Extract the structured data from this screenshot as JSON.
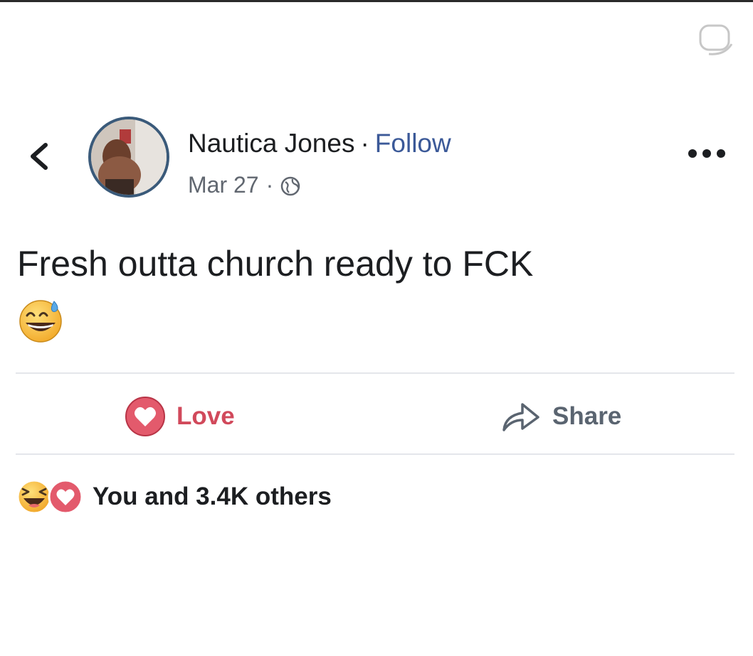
{
  "post": {
    "author": "Nautica Jones",
    "separator": "·",
    "follow_label": "Follow",
    "date": "Mar 27",
    "date_separator": "·",
    "audience_icon": "globe-icon",
    "text": "Fresh outta church ready to FCK",
    "emoji": "grinning-sweat-emoji"
  },
  "actions": {
    "love_label": "Love",
    "share_label": "Share"
  },
  "reactions": {
    "summary": "You and 3.4K others",
    "icons": [
      "laughing-emoji",
      "love-reaction-icon"
    ]
  },
  "colors": {
    "link_blue": "#3b5998",
    "love_red": "#d1495b",
    "secondary_gray": "#616770",
    "divider": "#e4e6eb"
  }
}
